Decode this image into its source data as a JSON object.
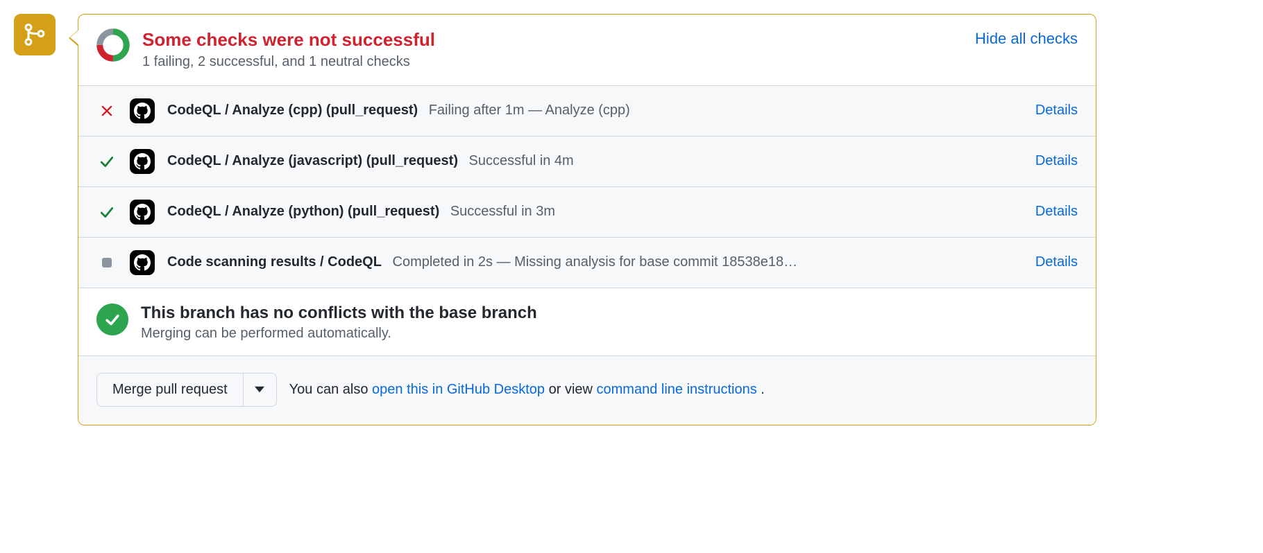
{
  "header": {
    "title": "Some checks were not successful",
    "subtitle": "1 failing, 2 successful, and 1 neutral checks",
    "hide_label": "Hide all checks"
  },
  "donut": {
    "success_color": "#2da44e",
    "fail_color": "#cf222e",
    "neutral_color": "#8c959f",
    "segments": [
      {
        "kind": "success",
        "fraction": 0.5
      },
      {
        "kind": "fail",
        "fraction": 0.25
      },
      {
        "kind": "neutral",
        "fraction": 0.25
      }
    ]
  },
  "checks": [
    {
      "status": "fail",
      "name": "CodeQL / Analyze (cpp) (pull_request)",
      "meta": "Failing after 1m — Analyze (cpp)",
      "details_label": "Details"
    },
    {
      "status": "success",
      "name": "CodeQL / Analyze (javascript) (pull_request)",
      "meta": "Successful in 4m",
      "details_label": "Details"
    },
    {
      "status": "success",
      "name": "CodeQL / Analyze (python) (pull_request)",
      "meta": "Successful in 3m",
      "details_label": "Details"
    },
    {
      "status": "neutral",
      "name": "Code scanning results / CodeQL",
      "meta": "Completed in 2s — Missing analysis for base commit 18538e18…",
      "details_label": "Details"
    }
  ],
  "merge_status": {
    "title": "This branch has no conflicts with the base branch",
    "subtitle": "Merging can be performed automatically."
  },
  "actions": {
    "merge_label": "Merge pull request",
    "hint_prefix": "You can also ",
    "desktop_link": "open this in GitHub Desktop",
    "hint_middle": " or view ",
    "cli_link": "command line instructions",
    "hint_suffix": "."
  }
}
